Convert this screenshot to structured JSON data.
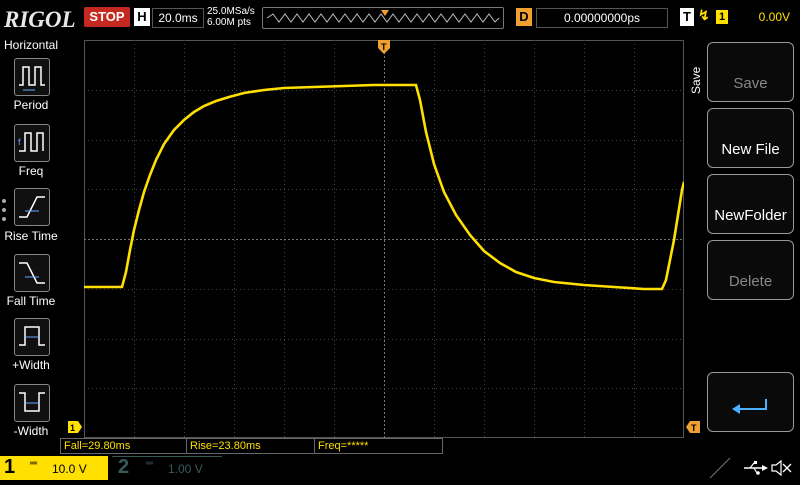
{
  "brand": "RIGOL",
  "status": "STOP",
  "horizontal": {
    "label": "H",
    "timebase": "20.0ms",
    "sample_rate": "25.0MSa/s",
    "memory_depth": "6.00M pts"
  },
  "delay": {
    "label": "D",
    "value": "0.00000000ps"
  },
  "trigger": {
    "label": "T",
    "channel": "1",
    "level": "0.00V"
  },
  "left_menu": {
    "title": "Horizontal",
    "items": [
      {
        "label": "Period",
        "icon": "period-icon"
      },
      {
        "label": "Freq",
        "icon": "freq-icon"
      },
      {
        "label": "Rise Time",
        "icon": "rise-time-icon"
      },
      {
        "label": "Fall Time",
        "icon": "fall-time-icon"
      },
      {
        "label": "+Width",
        "icon": "positive-width-icon"
      },
      {
        "label": "-Width",
        "icon": "negative-width-icon"
      }
    ]
  },
  "right_menu": {
    "title": "Save",
    "items": [
      {
        "label": "Save",
        "enabled": false
      },
      {
        "label": "New File",
        "enabled": true
      },
      {
        "label": "NewFolder",
        "enabled": true
      },
      {
        "label": "Delete",
        "enabled": false
      },
      {
        "label": "",
        "icon": "return-icon",
        "enabled": true
      }
    ]
  },
  "measurements": [
    {
      "text": "Fall=29.80ms"
    },
    {
      "text": "Rise=23.80ms"
    },
    {
      "text": "Freq=*****"
    }
  ],
  "channels": [
    {
      "num": "1",
      "scale": "10.0 V",
      "active": true,
      "color": "#ffe000"
    },
    {
      "num": "2",
      "scale": "1.00 V",
      "active": false,
      "color": "#3a5a5a"
    }
  ],
  "markers": {
    "ch1_ground": "1",
    "trigger_time": "T",
    "trigger_level": "T"
  },
  "colors": {
    "ch1": "#ffe000",
    "stop": "#c42a1f",
    "delay": "#f0a030",
    "trigger_marker": "#f0a030"
  }
}
